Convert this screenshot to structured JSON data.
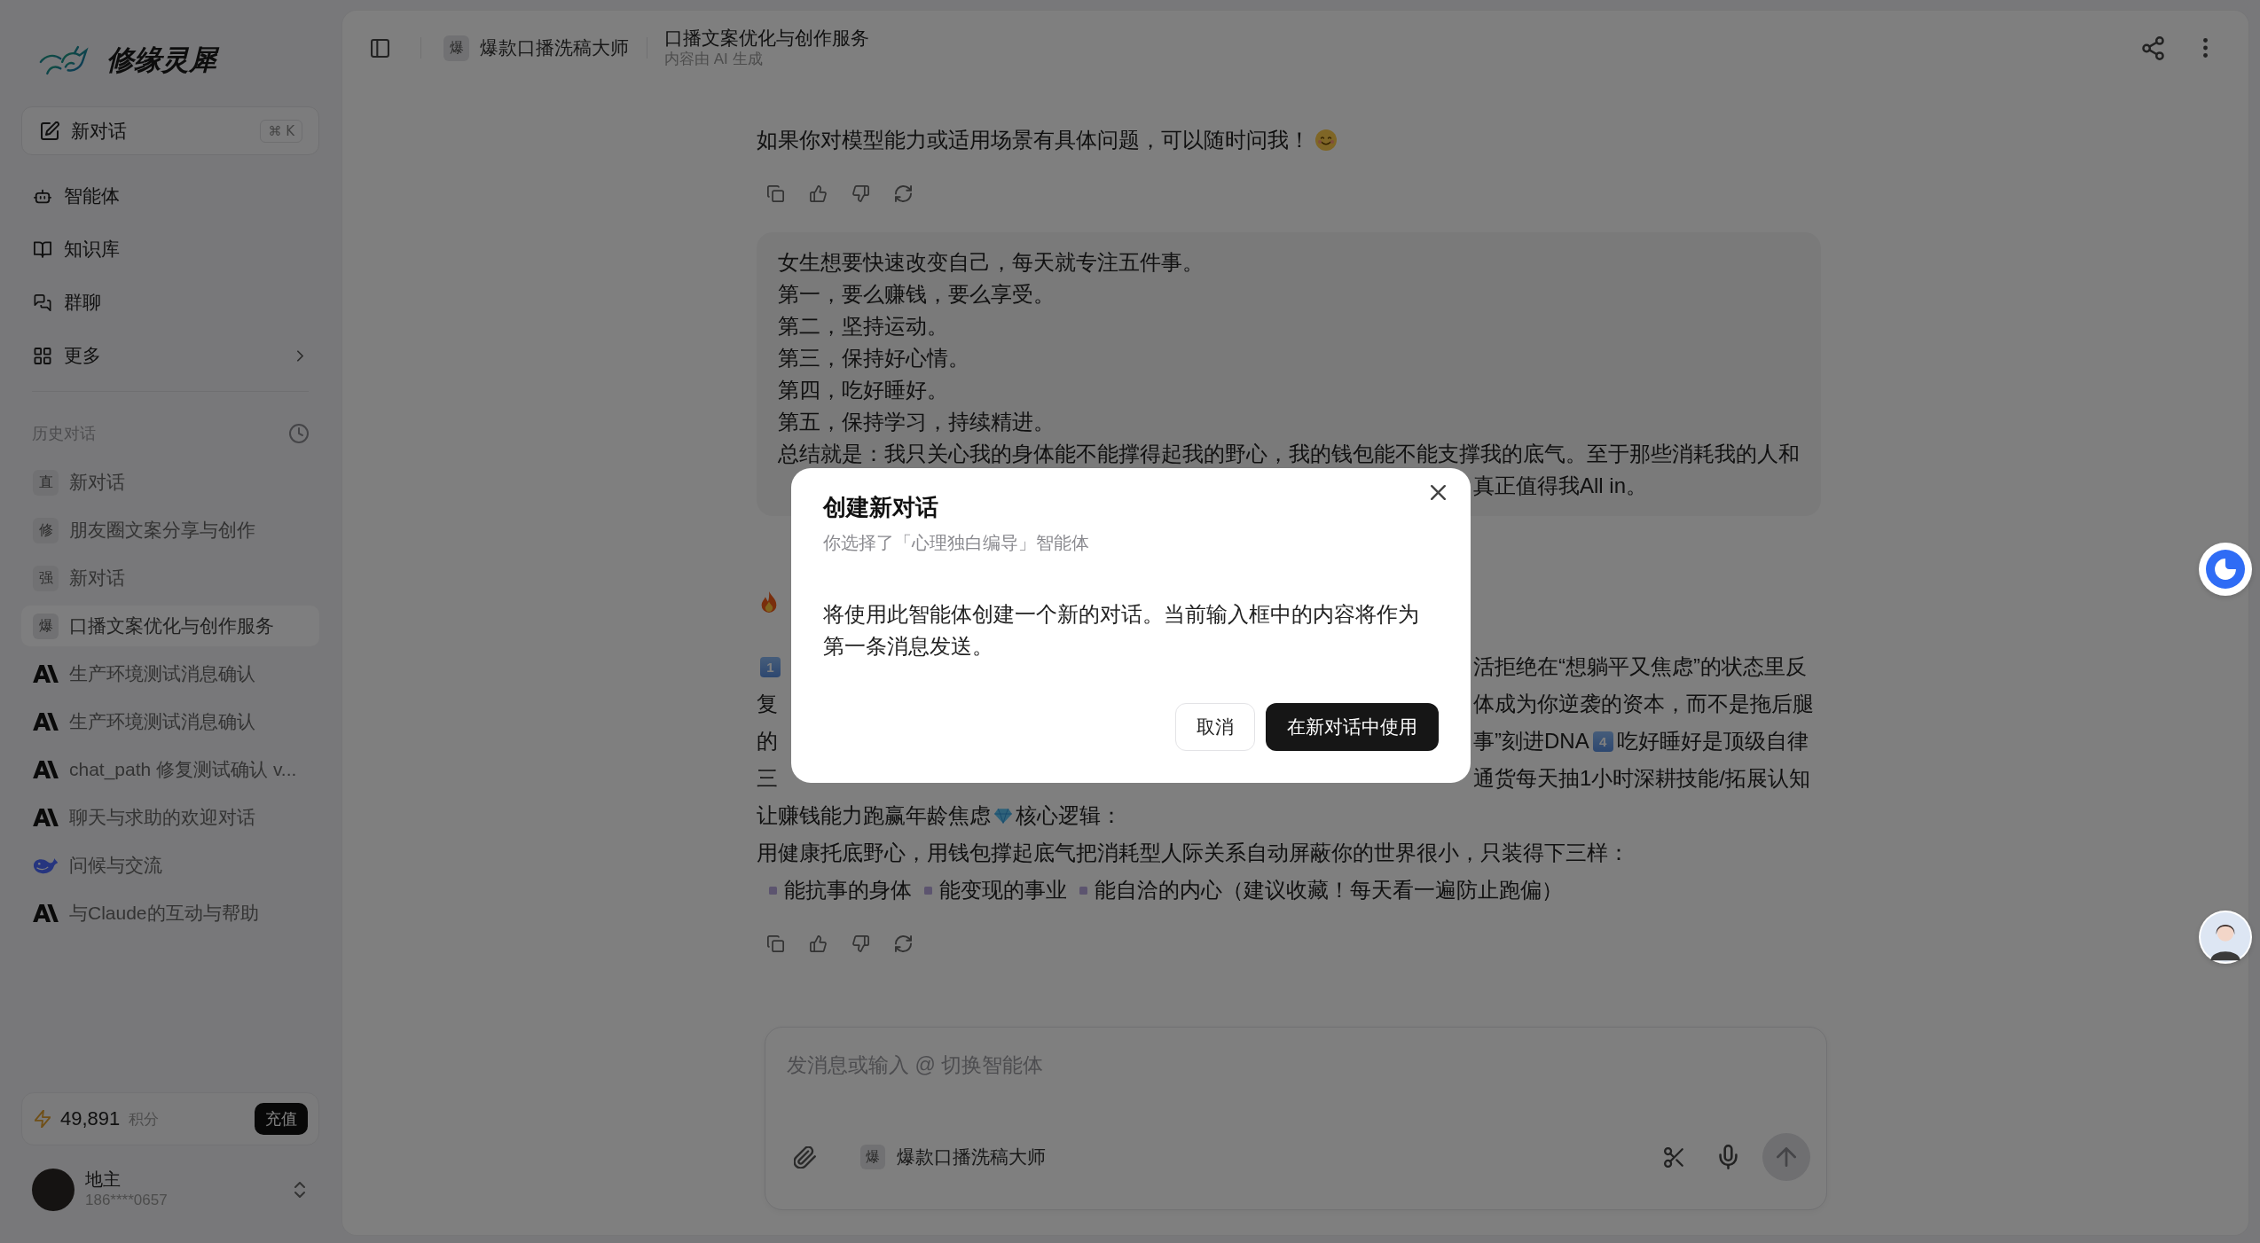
{
  "sidebar": {
    "logo": "修缘灵犀",
    "new_chat": {
      "label": "新对话",
      "shortcut": "⌘ K"
    },
    "nav": [
      {
        "label": "智能体",
        "submenu": false
      },
      {
        "label": "知识库",
        "submenu": false
      },
      {
        "label": "群聊",
        "submenu": false
      },
      {
        "label": "更多",
        "submenu": true
      }
    ],
    "history_title": "历史对话",
    "history": [
      {
        "kind": "badge",
        "badge": "直",
        "title": "新对话",
        "selected": false
      },
      {
        "kind": "badge",
        "badge": "修",
        "title": "朋友圈文案分享与创作",
        "selected": false
      },
      {
        "kind": "badge",
        "badge": "强",
        "title": "新对话",
        "selected": false
      },
      {
        "kind": "badge",
        "badge": "爆",
        "title": "口播文案优化与创作服务",
        "selected": true
      },
      {
        "kind": "mark",
        "title": "生产环境测试消息确认",
        "selected": false
      },
      {
        "kind": "mark",
        "title": "生产环境测试消息确认",
        "selected": false
      },
      {
        "kind": "mark",
        "title": "chat_path 修复测试确认 v...",
        "selected": false
      },
      {
        "kind": "mark",
        "title": "聊天与求助的欢迎对话",
        "selected": false
      },
      {
        "kind": "whale",
        "title": "问候与交流",
        "selected": false
      },
      {
        "kind": "mark",
        "title": "与Claude的互动与帮助",
        "selected": false
      }
    ],
    "credits": {
      "amount": "49,891",
      "unit": "积分",
      "button": "充值"
    },
    "user": {
      "name": "地主",
      "phone": "186****0657"
    }
  },
  "header": {
    "agent_badge": "爆",
    "agent_name": "爆款口播洗稿大师",
    "title": "口播文案优化与创作服务",
    "subtitle": "内容由 AI 生成"
  },
  "messages": [
    {
      "kind": "assistant",
      "paragraphs": [
        [
          {
            "kind": "plain",
            "parts": [
              {
                "kind": "text",
                "text": "如果你对模型能力或适用场景有具体问题，可以随时问我！"
              },
              {
                "kind": "smile"
              }
            ]
          }
        ]
      ]
    },
    {
      "kind": "user",
      "paragraphs": [
        [
          {
            "kind": "plain",
            "parts": [
              {
                "kind": "text",
                "text": "女生想要快速改变自己，每天就专注五件事。"
              }
            ]
          },
          {
            "kind": "plain",
            "parts": [
              {
                "kind": "text",
                "text": "第一，要么赚钱，要么享受。"
              }
            ]
          },
          {
            "kind": "plain",
            "parts": [
              {
                "kind": "text",
                "text": "第二，坚持运动。"
              }
            ]
          },
          {
            "kind": "plain",
            "parts": [
              {
                "kind": "text",
                "text": "第三，保持好心情。"
              }
            ]
          },
          {
            "kind": "plain",
            "parts": [
              {
                "kind": "text",
                "text": "第四，吃好睡好。"
              }
            ]
          },
          {
            "kind": "plain",
            "parts": [
              {
                "kind": "text",
                "text": "第五，保持学习，持续精进。"
              }
            ]
          },
          {
            "kind": "plain",
            "parts": [
              {
                "kind": "text",
                "text": "总结就是：我只关心我的身体能不能撑得起我的野心，我的钱包能不能支撑我的底气。至于那些消耗我的人和"
              }
            ]
          },
          {
            "kind": "split",
            "right": [
              {
                "kind": "text",
                "text": "真正值得我All in。"
              }
            ]
          }
        ]
      ]
    },
    {
      "kind": "assistant",
      "paragraphs": [
        [
          {
            "kind": "split",
            "left": [
              {
                "kind": "fire"
              }
            ]
          }
        ],
        [
          {
            "kind": "split",
            "left": [
              {
                "kind": "keycap",
                "text": "1"
              }
            ],
            "right": [
              {
                "kind": "text",
                "text": "活拒绝在“想躺平又焦虑”的状态里反"
              }
            ]
          },
          {
            "kind": "split",
            "left": [
              {
                "kind": "text",
                "text": "复"
              }
            ],
            "right": [
              {
                "kind": "text",
                "text": "体成为你逆袭的资本，而不是拖后腿"
              }
            ]
          },
          {
            "kind": "split",
            "left": [
              {
                "kind": "text",
                "text": "的"
              }
            ],
            "right": [
              {
                "kind": "text",
                "text": "事”刻进DNA"
              },
              {
                "kind": "keycap",
                "text": "4"
              },
              {
                "kind": "text",
                "text": "吃好睡好是顶级自律"
              }
            ]
          },
          {
            "kind": "split",
            "left": [
              {
                "kind": "text",
                "text": "三"
              }
            ],
            "right": [
              {
                "kind": "text",
                "text": "通货每天抽1小时深耕技能/拓展认知"
              }
            ]
          },
          {
            "kind": "plain",
            "parts": [
              {
                "kind": "text",
                "text": "让赚钱能力跑赢年龄焦虑"
              },
              {
                "kind": "gem"
              },
              {
                "kind": "text",
                "text": "核心逻辑："
              }
            ]
          },
          {
            "kind": "plain",
            "parts": [
              {
                "kind": "text",
                "text": "用健康托底野心，用钱包撑起底气把消耗型人际关系自动屏蔽你的世界很小，只装得下三样："
              }
            ]
          },
          {
            "kind": "plain",
            "parts": [
              {
                "kind": "bullet"
              },
              {
                "kind": "text",
                "text": "能抗事的身体"
              },
              {
                "kind": "bullet"
              },
              {
                "kind": "text",
                "text": "能变现的事业"
              },
              {
                "kind": "bullet"
              },
              {
                "kind": "text",
                "text": "能自洽的内心（建议收藏！每天看一遍防止跑偏）"
              }
            ]
          }
        ]
      ]
    }
  ],
  "composer": {
    "placeholder": "发消息或输入 @ 切换智能体",
    "agent_badge": "爆",
    "agent_name": "爆款口播洗稿大师"
  },
  "dialog": {
    "title": "创建新对话",
    "subtitle": "你选择了「心理独白编导」智能体",
    "body": "将使用此智能体创建一个新的对话。当前输入框中的内容将作为第一条消息发送。",
    "buttons": [
      {
        "kind": "secondary",
        "label": "取消"
      },
      {
        "kind": "primary",
        "label": "在新对话中使用"
      }
    ]
  }
}
